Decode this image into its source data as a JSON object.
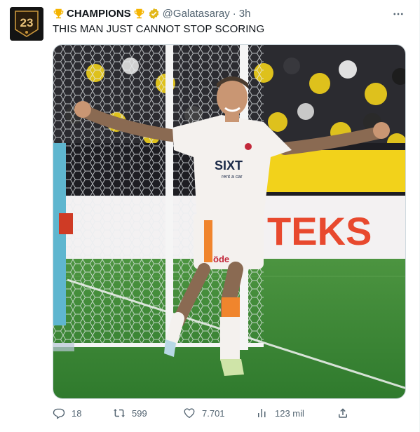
{
  "tweet": {
    "display_name": "CHAMPIONS",
    "handle": "@Galatasaray",
    "separator": "·",
    "time": "3h",
    "text": "THIS MAN JUST CANNOT STOP SCORING",
    "avatar_text": "23",
    "icons": {
      "name_prefix": "trophy-icon",
      "name_suffix": "trophy-icon",
      "badge": "verified-gold-badge-icon",
      "more": "more-horizontal-icon"
    },
    "media": {
      "banner_text": "TEKS",
      "sponsor_text": "SIXT",
      "sponsor_sub": "rent a car",
      "shorts_text": "öde",
      "colors": {
        "pitch": "#3f8a3a",
        "kit": "#f4f1ee",
        "accent": "#f0852d",
        "crowd_yellow": "#f2d21b",
        "banner_red": "#e8492e"
      }
    }
  },
  "actions": {
    "reply": {
      "icon": "reply-icon",
      "count": "18"
    },
    "retweet": {
      "icon": "retweet-icon",
      "count": "599"
    },
    "like": {
      "icon": "heart-icon",
      "count": "7.701"
    },
    "views": {
      "icon": "views-icon",
      "count": "123 mil"
    },
    "share": {
      "icon": "share-icon"
    }
  },
  "colors": {
    "text_primary": "#0f1419",
    "text_secondary": "#536471",
    "verified_gold": "#e2b719"
  }
}
